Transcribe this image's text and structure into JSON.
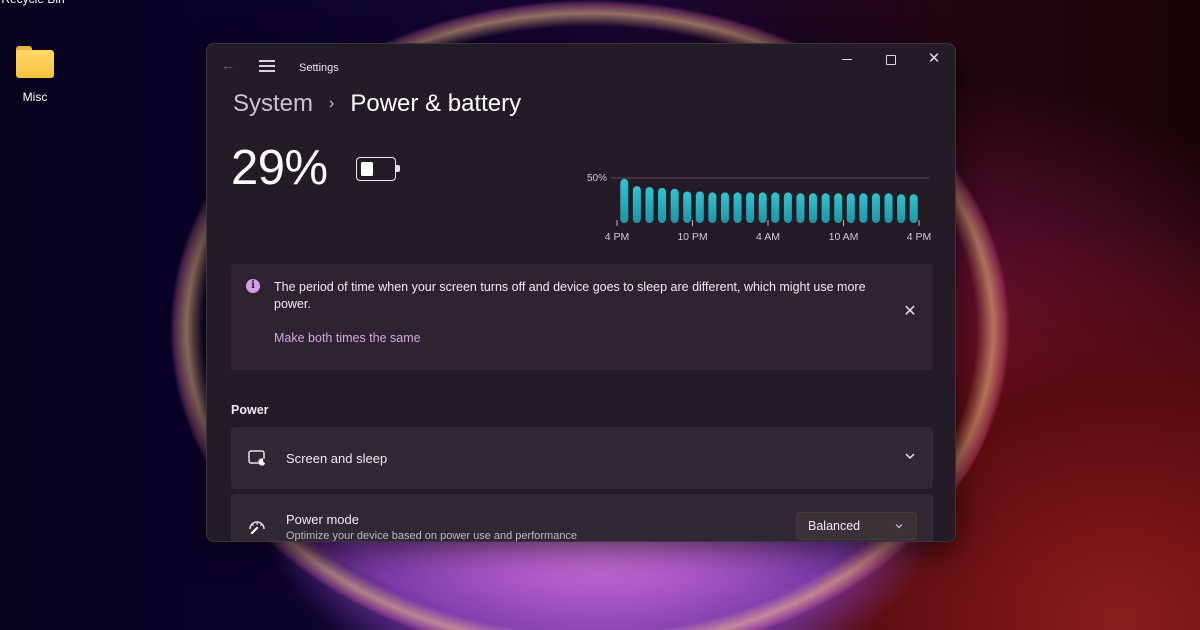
{
  "desktop": {
    "icons": [
      {
        "label": "Recycle Bin",
        "icon": "recycle-bin-icon"
      },
      {
        "label": "Misc",
        "icon": "folder-icon"
      }
    ]
  },
  "window": {
    "app_title": "Settings",
    "controls": {
      "back": "back-arrow-icon",
      "menu": "hamburger-menu-icon",
      "minimize": "minimize-icon",
      "maximize": "maximize-icon",
      "close": "close-icon"
    },
    "close_glyph": "✕",
    "back_glyph": "←"
  },
  "breadcrumb": {
    "parent": "System",
    "separator": "›",
    "current": "Power & battery"
  },
  "battery": {
    "percent_label": "29%",
    "level": 0.29
  },
  "chart_data": {
    "type": "bar",
    "title": "",
    "xlabel": "",
    "ylabel": "",
    "y_reference_label": "50%",
    "y_reference": 50,
    "ylim": [
      0,
      50
    ],
    "x_tick_labels": [
      "4 PM",
      "10 PM",
      "4 AM",
      "10 AM",
      "4 PM"
    ],
    "x_range_hours": [
      0,
      24
    ],
    "x_tick_hours": [
      0,
      6,
      12,
      18,
      24
    ],
    "bar_color": "#2ab3c0",
    "values": [
      49,
      41,
      40,
      39,
      38,
      35,
      35,
      34,
      34,
      34,
      34,
      34,
      34,
      34,
      33,
      33,
      33,
      33,
      33,
      33,
      33,
      33,
      32,
      32
    ]
  },
  "notification": {
    "icon": "info-icon",
    "icon_glyph": "i",
    "message": "The period of time when your screen turns off and device goes to sleep are different, which might use more power.",
    "action_link": "Make both times the same",
    "close_glyph": "✕"
  },
  "power_section": {
    "title": "Power",
    "items": [
      {
        "label": "Screen and sleep",
        "icon": "screen-sleep-icon",
        "expanded": false
      },
      {
        "label": "Power mode",
        "subtitle": "Optimize your device based on power use and performance",
        "icon": "power-mode-gauge-icon",
        "dropdown_value": "Balanced"
      }
    ]
  },
  "colors": {
    "accent_link": "#d5a6e4",
    "info_icon": "#d79ce8",
    "chart_bar": "#2ab3c0",
    "window_bg": "#231c26",
    "card_bg": "#302833"
  }
}
